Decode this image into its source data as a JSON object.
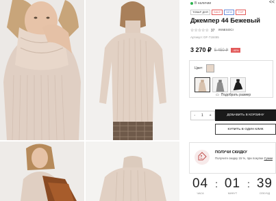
{
  "product": {
    "stock": "В наличии",
    "share_icon": "share-icon",
    "badges": [
      "ТОВАР ДНЯ",
      "SALE",
      "NEW",
      "TOP"
    ],
    "title": "Джемпер 44 Бежевый",
    "stars": "☆☆☆☆☆",
    "rating_count": "37",
    "brand": "INNESOCI",
    "article": "Артикул: DF-718455",
    "price": "3 270 ₽",
    "old_price": "5 450 ₽",
    "discount": "-40%",
    "color_label": "Цвет:",
    "size_label": "Подобрать размер"
  },
  "cart": {
    "qty_minus": "-",
    "qty_value": "1",
    "qty_plus": "+",
    "add_to_cart": "ДОБАВИТЬ В КОРЗИНУ",
    "one_click": "КУПИТЬ В ОДИН КЛИК"
  },
  "promo": {
    "title": "ПОЛУЧИ СКИДКУ",
    "text": "Получите скидку 15 %, при покупке",
    "link": "Сумки"
  },
  "timer": {
    "hours": "04",
    "minutes": "01",
    "seconds": "39",
    "hours_label": "ЧАСА",
    "minutes_label": "МИНУТ",
    "seconds_label": "СЕКУНД"
  }
}
